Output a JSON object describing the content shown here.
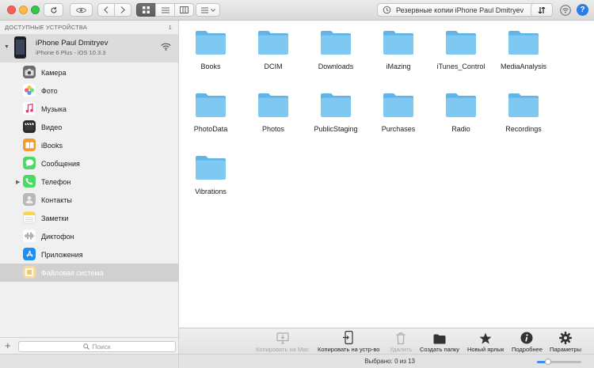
{
  "toolbar": {
    "backup_label": "Резервные копии iPhone Paul Dmitryev"
  },
  "sidebar": {
    "header": "ДОСТУПНЫЕ УСТРОЙСТВА",
    "header_count": "1",
    "device_name": "iPhone Paul Dmitryev",
    "device_sub": "iPhone 6 Plus - iOS 10.3.3",
    "items": [
      {
        "label": "Камера",
        "icon": "camera-icon",
        "color": "#6d6d6d"
      },
      {
        "label": "Фото",
        "icon": "photos-icon",
        "color": "#ffffff"
      },
      {
        "label": "Музыка",
        "icon": "music-icon",
        "color": "#ffffff"
      },
      {
        "label": "Видео",
        "icon": "video-icon",
        "color": "#2b2b2b"
      },
      {
        "label": "iBooks",
        "icon": "ibooks-icon",
        "color": "#f29a2e"
      },
      {
        "label": "Сообщения",
        "icon": "messages-icon",
        "color": "#4cd964"
      },
      {
        "label": "Телефон",
        "icon": "phone-icon",
        "color": "#4cd964"
      },
      {
        "label": "Контакты",
        "icon": "contacts-icon",
        "color": "#b8b8b8"
      },
      {
        "label": "Заметки",
        "icon": "notes-icon",
        "color": "#fbd54a"
      },
      {
        "label": "Диктофон",
        "icon": "voice-memos-icon",
        "color": "#ffffff"
      },
      {
        "label": "Приложения",
        "icon": "app-store-icon",
        "color": "#1c8ef5"
      },
      {
        "label": "Файловая система",
        "icon": "file-system-icon",
        "color": "#f4c76b"
      }
    ],
    "search_placeholder": "Поиск"
  },
  "folders": [
    "Books",
    "DCIM",
    "Downloads",
    "iMazing",
    "iTunes_Control",
    "MediaAnalysis",
    "PhotoData",
    "Photos",
    "PublicStaging",
    "Purchases",
    "Radio",
    "Recordings",
    "Vibrations"
  ],
  "actions": [
    {
      "label": "Копировать на Mac",
      "icon": "copy-to-mac-icon",
      "enabled": false
    },
    {
      "label": "Копировать на устр-во",
      "icon": "copy-to-device-icon",
      "enabled": true
    },
    {
      "label": "Удалить",
      "icon": "trash-icon",
      "enabled": false
    },
    {
      "label": "Создать папку",
      "icon": "new-folder-icon",
      "enabled": true
    },
    {
      "label": "Новый ярлык",
      "icon": "star-icon",
      "enabled": true
    },
    {
      "label": "Подробнее",
      "icon": "info-icon",
      "enabled": true
    },
    {
      "label": "Параметры",
      "icon": "gear-icon",
      "enabled": true
    }
  ],
  "status": {
    "selection": "Выбрано: 0 из 13",
    "zoom_level": 0.25
  },
  "colors": {
    "folder": "#7ec8f2",
    "accent": "#3b8ff0",
    "selected_row": "#d0d0d0"
  }
}
